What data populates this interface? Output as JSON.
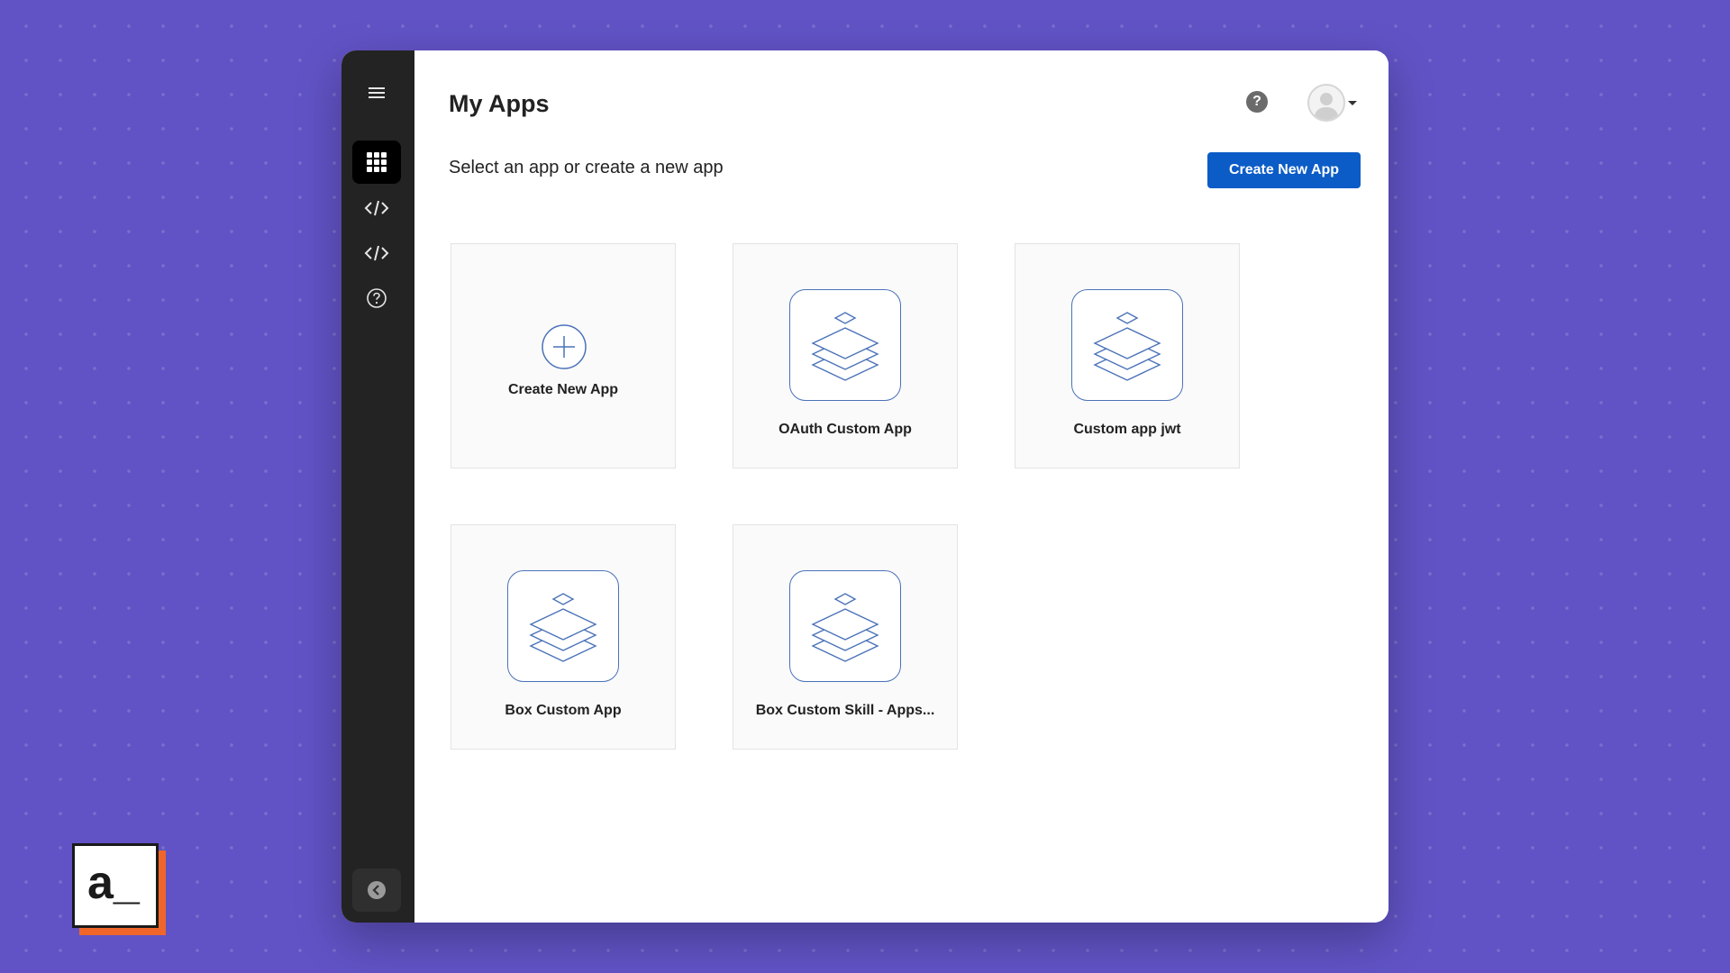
{
  "header": {
    "title": "My Apps",
    "subtitle": "Select an app or create a new app",
    "create_button": "Create New App",
    "help_glyph": "?"
  },
  "sidebar": {
    "items": [
      {
        "icon": "menu-icon"
      },
      {
        "icon": "apps-grid-icon",
        "active": true
      },
      {
        "icon": "code-icon"
      },
      {
        "icon": "code-icon"
      },
      {
        "icon": "help-circle-icon"
      }
    ],
    "collapse_icon": "chevron-left-icon"
  },
  "apps": [
    {
      "label": "Create New App",
      "icon": "plus-circle-icon"
    },
    {
      "label": "OAuth Custom App",
      "icon": "layers-icon"
    },
    {
      "label": "Custom app jwt",
      "icon": "layers-icon"
    },
    {
      "label": "Box Custom App",
      "icon": "layers-icon"
    },
    {
      "label": "Box Custom Skill - Apps...",
      "icon": "layers-icon"
    }
  ],
  "colors": {
    "background": "#6153c5",
    "sidebar": "#232323",
    "primary": "#0b5cc7",
    "icon_stroke": "#4a72b8",
    "logo_accent": "#f0662a"
  },
  "logo": {
    "text": "a_"
  }
}
